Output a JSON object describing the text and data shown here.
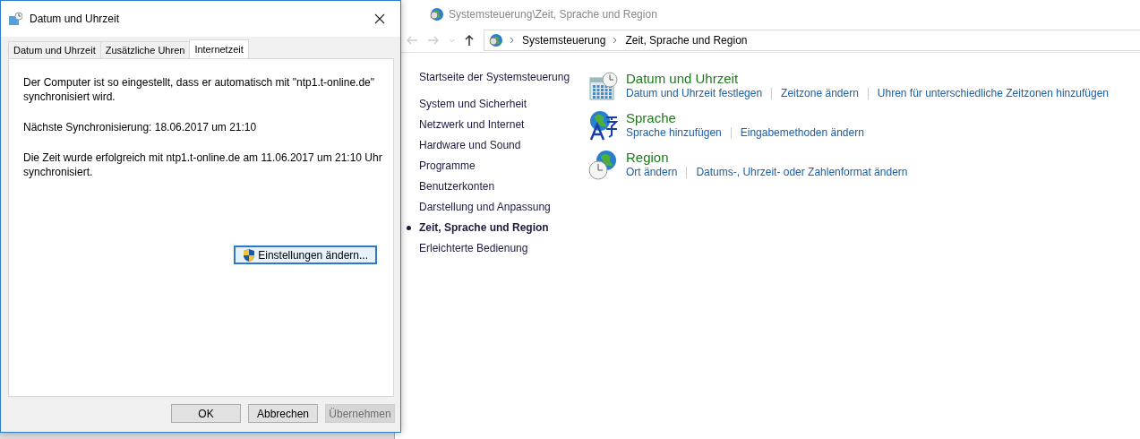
{
  "dialog": {
    "title": "Datum und Uhrzeit",
    "tabs": [
      {
        "label": "Datum und Uhrzeit",
        "selected": false
      },
      {
        "label": "Zusätzliche Uhren",
        "selected": false
      },
      {
        "label": "Internetzeit",
        "selected": true
      }
    ],
    "paragraphs": [
      "Der Computer ist so eingestellt, dass er automatisch mit \"ntp1.t-online.de\" synchronisiert wird.",
      "Nächste Synchronisierung: 18.06.2017 um 21:10",
      "Die Zeit wurde erfolgreich mit ntp1.t-online.de am 11.06.2017 um 21:10 Uhr synchronisiert."
    ],
    "change_button": "Einstellungen ändern...",
    "buttons": [
      {
        "label": "OK",
        "disabled": false
      },
      {
        "label": "Abbrechen",
        "disabled": false
      },
      {
        "label": "Übernehmen",
        "disabled": true
      }
    ]
  },
  "control_panel": {
    "title": "Systemsteuerung\\Zeit, Sprache und Region",
    "breadcrumb": [
      "Systemsteuerung",
      "Zeit, Sprache und Region"
    ],
    "sidebar": {
      "home": "Startseite der Systemsteuerung",
      "items": [
        {
          "label": "System und Sicherheit",
          "selected": false
        },
        {
          "label": "Netzwerk und Internet",
          "selected": false
        },
        {
          "label": "Hardware und Sound",
          "selected": false
        },
        {
          "label": "Programme",
          "selected": false
        },
        {
          "label": "Benutzerkonten",
          "selected": false
        },
        {
          "label": "Darstellung und Anpassung",
          "selected": false
        },
        {
          "label": "Zeit, Sprache und Region",
          "selected": true
        },
        {
          "label": "Erleichterte Bedienung",
          "selected": false
        }
      ]
    },
    "categories": [
      {
        "kind": "calendar",
        "title": "Datum und Uhrzeit",
        "links": [
          "Datum und Uhrzeit festlegen",
          "Zeitzone ändern",
          "Uhren für unterschiedliche Zeitzonen hinzufügen"
        ]
      },
      {
        "kind": "language",
        "title": "Sprache",
        "links": [
          "Sprache hinzufügen",
          "Eingabemethoden ändern"
        ]
      },
      {
        "kind": "region",
        "title": "Region",
        "links": [
          "Ort ändern",
          "Datums-, Uhrzeit- oder Zahlenformat ändern"
        ]
      }
    ]
  }
}
